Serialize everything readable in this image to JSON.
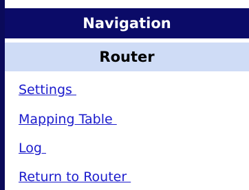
{
  "navigation": {
    "title": "Navigation",
    "section": "Router",
    "links": [
      {
        "label": "Settings "
      },
      {
        "label": "Mapping Table "
      },
      {
        "label": "Log "
      },
      {
        "label": "Return to Router "
      }
    ]
  },
  "colors": {
    "header_bg": "#0b0b68",
    "section_bg": "#cfdcf6",
    "link": "#1a1acc"
  }
}
